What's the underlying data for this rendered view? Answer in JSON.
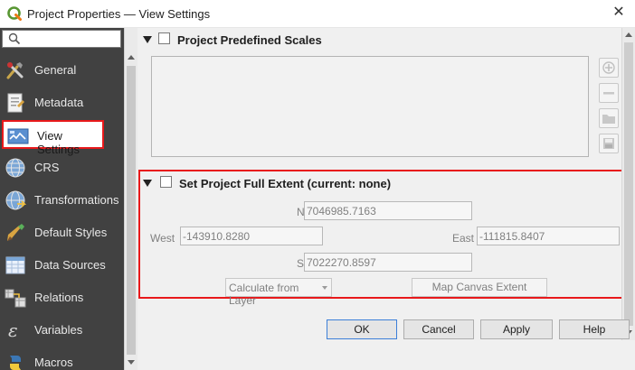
{
  "window": {
    "title": "Project Properties — View Settings",
    "close_glyph": "✕",
    "app_icon": "qgis-logo-icon"
  },
  "sidebar": {
    "search": {
      "placeholder": "",
      "icon": "search-icon"
    },
    "items": [
      {
        "label": "General",
        "icon": "tools-icon"
      },
      {
        "label": "Metadata",
        "icon": "metadata-icon"
      },
      {
        "label": "View Settings",
        "icon": "map-view-icon",
        "active": true
      },
      {
        "label": "CRS",
        "icon": "globe-icon"
      },
      {
        "label": "Transformations",
        "icon": "globe-transform-icon"
      },
      {
        "label": "Default Styles",
        "icon": "paintbrush-icon"
      },
      {
        "label": "Data Sources",
        "icon": "table-icon"
      },
      {
        "label": "Relations",
        "icon": "relations-icon"
      },
      {
        "label": "Variables",
        "icon": "variables-icon"
      },
      {
        "label": "Macros",
        "icon": "macros-icon"
      }
    ]
  },
  "predefined_scales": {
    "title": "Project Predefined Scales",
    "checked": false,
    "tools": [
      "add-scale-icon",
      "remove-scale-icon",
      "open-folder-icon",
      "save-icon"
    ]
  },
  "full_extent": {
    "title": "Set Project Full Extent (current: none)",
    "checked": false,
    "north_label": "North",
    "north_value": "7046985.7163",
    "west_label": "West",
    "west_value": "-143910.8280",
    "east_label": "East",
    "east_value": "-111815.8407",
    "south_label": "South",
    "south_value": "7022270.8597",
    "calculate_label": "Calculate from Layer",
    "map_canvas_label": "Map Canvas Extent"
  },
  "footer": {
    "ok": "OK",
    "cancel": "Cancel",
    "apply": "Apply",
    "help": "Help"
  },
  "colors": {
    "sidebar_bg": "#414141",
    "highlight": "#e8191b",
    "accent": "#3c7fd8"
  }
}
